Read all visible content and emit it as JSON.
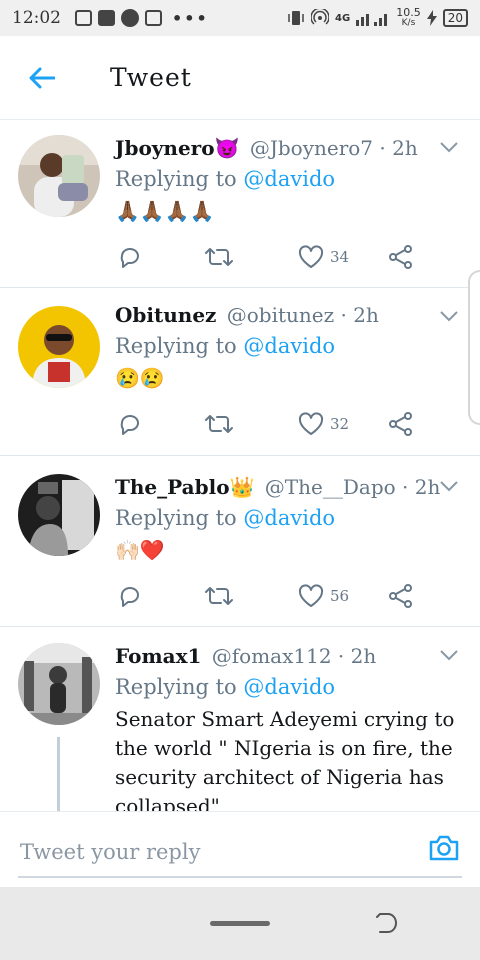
{
  "status_bar": {
    "time": "12:02",
    "network_type": "4G",
    "speed": "10.5",
    "speed_unit": "K/s",
    "battery": "20"
  },
  "header": {
    "title": "Tweet"
  },
  "tweets": [
    {
      "name": "Jboynero",
      "name_emoji": "😈",
      "handle": "@Jboynero7",
      "time": "· 2h",
      "replying_prefix": "Replying to",
      "replying_to": "@davido",
      "text": "🙏🏾🙏🏾🙏🏾🙏🏾",
      "likes": "34",
      "avatar_color": "#b7a899"
    },
    {
      "name": "Obitunez",
      "name_emoji": "",
      "handle": "@obitunez",
      "time": "· 2h",
      "replying_prefix": "Replying to",
      "replying_to": "@davido",
      "text": "😢😢",
      "likes": "32",
      "avatar_color": "#f2c500"
    },
    {
      "name": "The_Pablo",
      "name_emoji": "👑",
      "handle": "@The__Dapo",
      "time": "· 2h",
      "replying_prefix": "Replying to",
      "replying_to": "@davido",
      "text": "🙌🏻❤️",
      "likes": "56",
      "avatar_color": "#2b2b2b"
    },
    {
      "name": "Fomax1",
      "name_emoji": "",
      "handle": "@fomax112",
      "time": "· 2h",
      "replying_prefix": "Replying to",
      "replying_to": "@davido",
      "text": "Senator Smart Adeyemi crying to the world \" NIgeria is on fire, the security architect of Nigeria has collapsed\"",
      "likes": "",
      "avatar_color": "#6f6f6f"
    }
  ],
  "reply_bar": {
    "placeholder": "Tweet your reply"
  },
  "colors": {
    "accent": "#1da1f2",
    "secondary_text": "#657786",
    "divider": "#e1e8ed"
  },
  "icons": {
    "back": "arrow-left-icon",
    "reply": "comment-icon",
    "retweet": "retweet-icon",
    "like": "heart-icon",
    "share": "share-icon",
    "more": "chevron-down-icon",
    "camera": "camera-icon"
  }
}
